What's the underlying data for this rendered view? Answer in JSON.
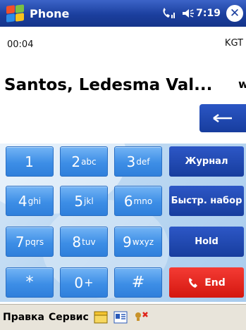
{
  "titlebar": {
    "title": "Phone",
    "time": "7:19",
    "close_glyph": "✕",
    "start_icon": "windows-flag-icon",
    "signal_icon": "phone-signal-icon",
    "volume_icon": "speaker-icon"
  },
  "call": {
    "duration": "00:04",
    "operator": "KGT",
    "contact_name": "Santos, Ledesma Val...",
    "contact_type": "w"
  },
  "backspace": {
    "icon": "left-arrow-icon"
  },
  "keypad": {
    "keys": [
      {
        "digit": "1",
        "letters": ""
      },
      {
        "digit": "2",
        "letters": "abc"
      },
      {
        "digit": "3",
        "letters": "def"
      },
      {
        "digit": "4",
        "letters": "ghi"
      },
      {
        "digit": "5",
        "letters": "jkl"
      },
      {
        "digit": "6",
        "letters": "mno"
      },
      {
        "digit": "7",
        "letters": "pqrs"
      },
      {
        "digit": "8",
        "letters": "tuv"
      },
      {
        "digit": "9",
        "letters": "wxyz"
      },
      {
        "digit": "*",
        "letters": ""
      },
      {
        "digit": "0",
        "letters": "+"
      },
      {
        "digit": "#",
        "letters": ""
      }
    ],
    "functions": {
      "journal": "Журнал",
      "speed_dial": "Быстр. набор",
      "hold": "Hold",
      "end": "End"
    }
  },
  "menubar": {
    "edit": "Правка",
    "service": "Сервис",
    "icons": [
      "folder-icon",
      "contact-card-icon",
      "mute-mic-icon"
    ]
  },
  "colors": {
    "titlebar": "#1b3f9e",
    "key_blue": "#3d8ee6",
    "function_blue": "#173d9e",
    "end_red": "#e0241b",
    "menubar": "#e8e4da"
  }
}
